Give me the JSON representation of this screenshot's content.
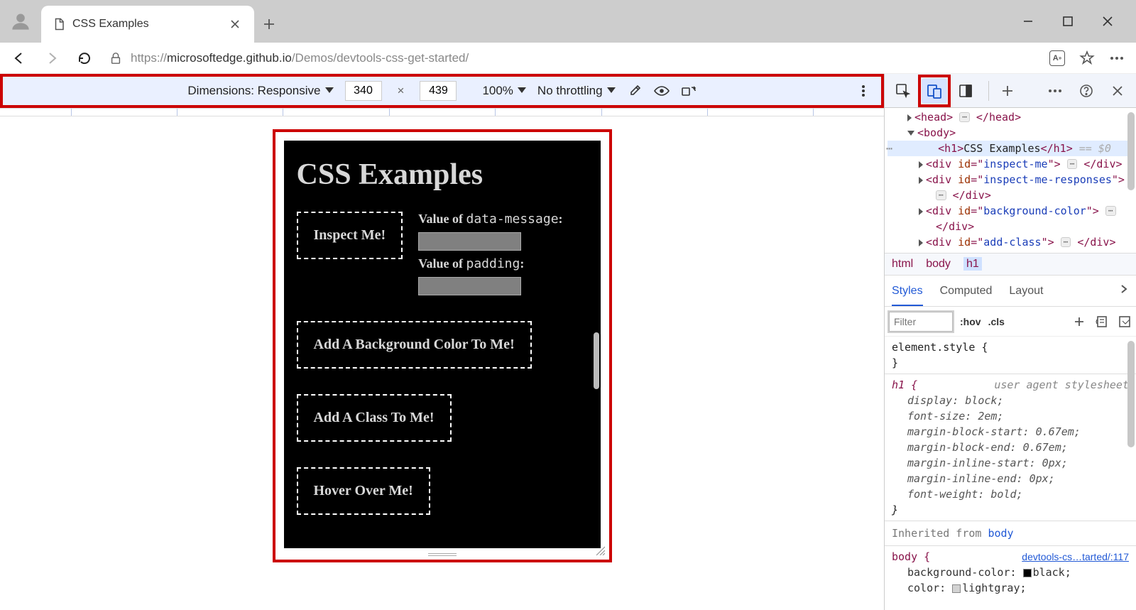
{
  "browser": {
    "tab_title": "CSS Examples",
    "url_prefix": "https://",
    "url_host": "microsoftedge.github.io",
    "url_path": "/Demos/devtools-css-get-started/"
  },
  "device_toolbar": {
    "dimensions_label": "Dimensions: Responsive",
    "width": "340",
    "height": "439",
    "zoom": "100%",
    "throttling": "No throttling"
  },
  "page": {
    "h1": "CSS Examples",
    "inspect": "Inspect Me!",
    "val_data_message": "Value of data-message:",
    "val_padding": "Value of padding:",
    "add_bg": "Add A Background Color To Me!",
    "add_class": "Add A Class To Me!",
    "hover": "Hover Over Me!"
  },
  "dom": {
    "head": "head",
    "body": "body",
    "h1": "h1",
    "h1_text": "CSS Examples",
    "eq0": " == $0",
    "div": "div",
    "id_attr": "id",
    "inspect_me": "inspect-me",
    "inspect_me_responses": "inspect-me-responses",
    "background_color": "background-color",
    "add_class": "add-class"
  },
  "breadcrumb": {
    "l0": "html",
    "l1": "body",
    "l2": "h1"
  },
  "styles_tabs": {
    "styles": "Styles",
    "computed": "Computed",
    "layout": "Layout"
  },
  "filter_row": {
    "placeholder": "Filter",
    "hov": ":hov",
    "cls": ".cls"
  },
  "styles": {
    "elstyle": "element.style {",
    "close": "}",
    "h1sel": "h1 {",
    "ua": "user agent stylesheet",
    "p_display": "display:",
    "v_display": "block;",
    "p_fontsize": "font-size:",
    "v_fontsize": "2em;",
    "p_mbs": "margin-block-start:",
    "v_mbs": "0.67em;",
    "p_mbe": "margin-block-end:",
    "v_mbe": "0.67em;",
    "p_mis": "margin-inline-start:",
    "v_mis": "0px;",
    "p_mie": "margin-inline-end:",
    "v_mie": "0px;",
    "p_fw": "font-weight:",
    "v_fw": "bold;",
    "inherited": "Inherited from ",
    "inh_body": "body",
    "bodysel": "body {",
    "src": "devtools-cs…tarted/:117",
    "p_bg": "background-color:",
    "v_bg": "black;",
    "p_col": "color:",
    "v_col": "lightgray;"
  }
}
